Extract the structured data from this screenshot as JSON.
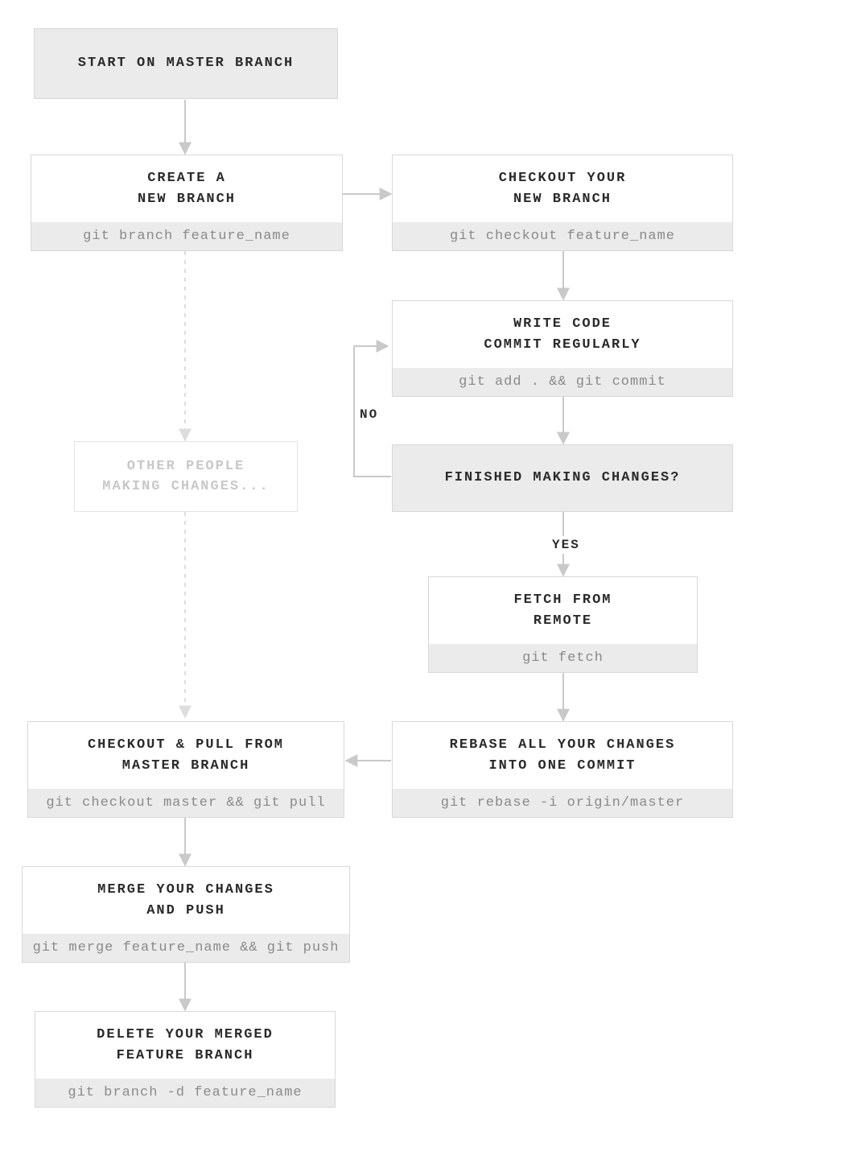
{
  "nodes": {
    "start": {
      "title": "START ON MASTER BRANCH"
    },
    "create": {
      "title": "CREATE A\nNEW BRANCH",
      "cmd": "git branch feature_name"
    },
    "checkout": {
      "title": "CHECKOUT YOUR\nNEW BRANCH",
      "cmd": "git checkout feature_name"
    },
    "write": {
      "title": "WRITE CODE\nCOMMIT REGULARLY",
      "cmd": "git add . && git commit"
    },
    "finished": {
      "title": "FINISHED MAKING CHANGES?"
    },
    "others": {
      "title": "OTHER PEOPLE\nMAKING CHANGES..."
    },
    "fetch": {
      "title": "FETCH FROM\nREMOTE",
      "cmd": "git fetch"
    },
    "rebase": {
      "title": "REBASE ALL YOUR CHANGES\nINTO ONE COMMIT",
      "cmd": "git rebase -i origin/master"
    },
    "pull": {
      "title": "CHECKOUT & PULL FROM\nMASTER BRANCH",
      "cmd": "git checkout master && git pull"
    },
    "merge": {
      "title": "MERGE YOUR CHANGES\nAND PUSH",
      "cmd": "git merge feature_name && git push"
    },
    "delete": {
      "title": "DELETE YOUR MERGED\nFEATURE BRANCH",
      "cmd": "git branch -d feature_name"
    }
  },
  "labels": {
    "no": "NO",
    "yes": "YES"
  }
}
